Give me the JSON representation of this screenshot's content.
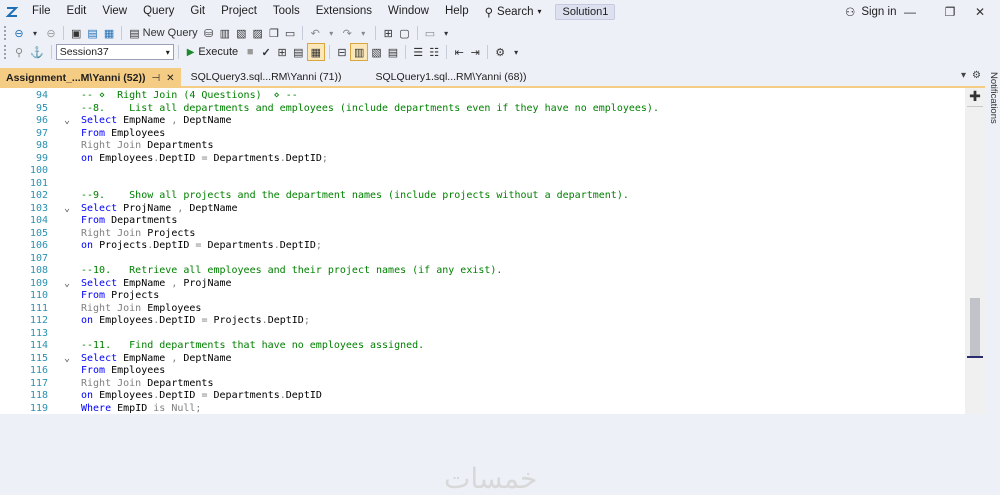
{
  "menu": {
    "items": [
      "File",
      "Edit",
      "View",
      "Query",
      "Git",
      "Project",
      "Tools",
      "Extensions",
      "Window",
      "Help"
    ],
    "search_label": "Search",
    "solution_label": "Solution1",
    "signin_label": "Sign in"
  },
  "toolbar": {
    "new_query_label": "New Query",
    "session_value": "Session37",
    "execute_label": "Execute"
  },
  "tabs": [
    {
      "label": "Assignment_...M\\Yanni (52))",
      "active": true
    },
    {
      "label": "SQLQuery3.sql...RM\\Yanni (71))",
      "active": false
    },
    {
      "label": "SQLQuery1.sql...RM\\Yanni (68))",
      "active": false
    }
  ],
  "side_panel": {
    "label": "Notifications"
  },
  "editor": {
    "lines": [
      {
        "n": "94",
        "fold": "",
        "tokens": [
          {
            "c": "cm",
            "t": "-- ⋄  Right Join (4 Questions)  ⋄ --"
          }
        ]
      },
      {
        "n": "95",
        "fold": "",
        "tokens": [
          {
            "c": "cm",
            "t": "--8.    List all departments and employees (include departments even if they have no employees)."
          }
        ]
      },
      {
        "n": "96",
        "fold": "v",
        "tokens": [
          {
            "c": "kw",
            "t": "Select"
          },
          {
            "c": "tx",
            "t": " EmpName "
          },
          {
            "c": "gr",
            "t": ","
          },
          {
            "c": "tx",
            "t": " DeptName"
          }
        ]
      },
      {
        "n": "97",
        "fold": "",
        "tokens": [
          {
            "c": "kw",
            "t": "From"
          },
          {
            "c": "tx",
            "t": " Employees"
          }
        ]
      },
      {
        "n": "98",
        "fold": "",
        "tokens": [
          {
            "c": "gr",
            "t": "Right Join"
          },
          {
            "c": "tx",
            "t": " Departments"
          }
        ]
      },
      {
        "n": "99",
        "fold": "",
        "tokens": [
          {
            "c": "kw",
            "t": "on"
          },
          {
            "c": "tx",
            "t": " Employees"
          },
          {
            "c": "gr",
            "t": "."
          },
          {
            "c": "tx",
            "t": "DeptID "
          },
          {
            "c": "gr",
            "t": "="
          },
          {
            "c": "tx",
            "t": " Departments"
          },
          {
            "c": "gr",
            "t": "."
          },
          {
            "c": "tx",
            "t": "DeptID"
          },
          {
            "c": "gr",
            "t": ";"
          }
        ]
      },
      {
        "n": "100",
        "fold": "",
        "tokens": []
      },
      {
        "n": "101",
        "fold": "",
        "tokens": []
      },
      {
        "n": "102",
        "fold": "",
        "tokens": [
          {
            "c": "cm",
            "t": "--9.    Show all projects and the department names (include projects without a department)."
          }
        ]
      },
      {
        "n": "103",
        "fold": "v",
        "tokens": [
          {
            "c": "kw",
            "t": "Select"
          },
          {
            "c": "tx",
            "t": " ProjName "
          },
          {
            "c": "gr",
            "t": ","
          },
          {
            "c": "tx",
            "t": " DeptName"
          }
        ]
      },
      {
        "n": "104",
        "fold": "",
        "tokens": [
          {
            "c": "kw",
            "t": "From"
          },
          {
            "c": "tx",
            "t": " Departments"
          }
        ]
      },
      {
        "n": "105",
        "fold": "",
        "tokens": [
          {
            "c": "gr",
            "t": "Right Join"
          },
          {
            "c": "tx",
            "t": " Projects"
          }
        ]
      },
      {
        "n": "106",
        "fold": "",
        "tokens": [
          {
            "c": "kw",
            "t": "on"
          },
          {
            "c": "tx",
            "t": " Projects"
          },
          {
            "c": "gr",
            "t": "."
          },
          {
            "c": "tx",
            "t": "DeptID "
          },
          {
            "c": "gr",
            "t": "="
          },
          {
            "c": "tx",
            "t": " Departments"
          },
          {
            "c": "gr",
            "t": "."
          },
          {
            "c": "tx",
            "t": "DeptID"
          },
          {
            "c": "gr",
            "t": ";"
          }
        ]
      },
      {
        "n": "107",
        "fold": "",
        "tokens": []
      },
      {
        "n": "108",
        "fold": "",
        "tokens": [
          {
            "c": "cm",
            "t": "--10.   Retrieve all employees and their project names (if any exist)."
          }
        ]
      },
      {
        "n": "109",
        "fold": "v",
        "tokens": [
          {
            "c": "kw",
            "t": "Select"
          },
          {
            "c": "tx",
            "t": " EmpName "
          },
          {
            "c": "gr",
            "t": ","
          },
          {
            "c": "tx",
            "t": " ProjName"
          }
        ]
      },
      {
        "n": "110",
        "fold": "",
        "tokens": [
          {
            "c": "kw",
            "t": "From"
          },
          {
            "c": "tx",
            "t": " Projects"
          }
        ]
      },
      {
        "n": "111",
        "fold": "",
        "tokens": [
          {
            "c": "gr",
            "t": "Right Join"
          },
          {
            "c": "tx",
            "t": " Employees"
          }
        ]
      },
      {
        "n": "112",
        "fold": "",
        "tokens": [
          {
            "c": "kw",
            "t": "on"
          },
          {
            "c": "tx",
            "t": " Employees"
          },
          {
            "c": "gr",
            "t": "."
          },
          {
            "c": "tx",
            "t": "DeptID "
          },
          {
            "c": "gr",
            "t": "="
          },
          {
            "c": "tx",
            "t": " Projects"
          },
          {
            "c": "gr",
            "t": "."
          },
          {
            "c": "tx",
            "t": "DeptID"
          },
          {
            "c": "gr",
            "t": ";"
          }
        ]
      },
      {
        "n": "113",
        "fold": "",
        "tokens": []
      },
      {
        "n": "114",
        "fold": "",
        "tokens": [
          {
            "c": "cm",
            "t": "--11.   Find departments that have no employees assigned."
          }
        ]
      },
      {
        "n": "115",
        "fold": "v",
        "tokens": [
          {
            "c": "kw",
            "t": "Select"
          },
          {
            "c": "tx",
            "t": " EmpName "
          },
          {
            "c": "gr",
            "t": ","
          },
          {
            "c": "tx",
            "t": " DeptName"
          }
        ]
      },
      {
        "n": "116",
        "fold": "",
        "tokens": [
          {
            "c": "kw",
            "t": "From"
          },
          {
            "c": "tx",
            "t": " Employees"
          }
        ]
      },
      {
        "n": "117",
        "fold": "",
        "tokens": [
          {
            "c": "gr",
            "t": "Right Join"
          },
          {
            "c": "tx",
            "t": " Departments"
          }
        ]
      },
      {
        "n": "118",
        "fold": "",
        "tokens": [
          {
            "c": "kw",
            "t": "on"
          },
          {
            "c": "tx",
            "t": " Employees"
          },
          {
            "c": "gr",
            "t": "."
          },
          {
            "c": "tx",
            "t": "DeptID "
          },
          {
            "c": "gr",
            "t": "="
          },
          {
            "c": "tx",
            "t": " Departments"
          },
          {
            "c": "gr",
            "t": "."
          },
          {
            "c": "tx",
            "t": "DeptID"
          }
        ]
      },
      {
        "n": "119",
        "fold": "",
        "tokens": [
          {
            "c": "kw",
            "t": "Where"
          },
          {
            "c": "tx",
            "t": " EmpID "
          },
          {
            "c": "gr",
            "t": "is Null"
          },
          {
            "c": "gr",
            "t": ";"
          }
        ]
      }
    ]
  },
  "watermark": "خمسات",
  "colors": {
    "active_tab": "#f5cc84",
    "keyword": "#0000ff",
    "comment": "#008000",
    "operator": "#808080",
    "line_number": "#2b91af"
  }
}
